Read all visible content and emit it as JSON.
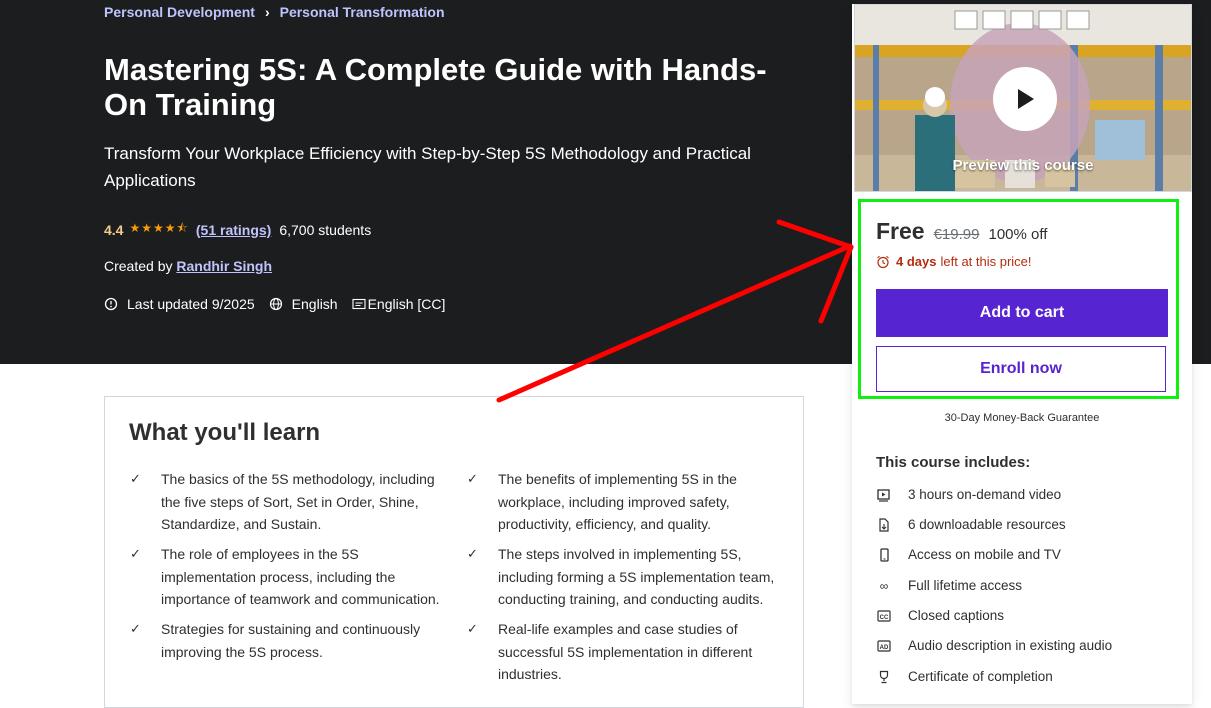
{
  "breadcrumb": {
    "items": [
      "Personal Development",
      "Personal Transformation"
    ]
  },
  "course": {
    "title": "Mastering 5S: A Complete Guide with Hands-On Training",
    "subtitle": "Transform Your Workplace Efficiency with Step-by-Step 5S Methodology and Practical Applications",
    "rating": "4.4",
    "rating_stars": 4.4,
    "ratings_count_label": "(51 ratings)",
    "students": "6,700 students",
    "created_by_label": "Created by",
    "instructor": "Randhir Singh",
    "last_updated": "Last updated 9/2025",
    "language": "English",
    "captions": "English [CC]"
  },
  "learn": {
    "heading": "What you'll learn",
    "items": [
      "The basics of the 5S methodology, including the five steps of Sort, Set in Order, Shine, Standardize, and Sustain.",
      "The benefits of implementing 5S in the workplace, including improved safety, productivity, efficiency, and quality.",
      "The role of employees in the 5S implementation process, including the importance of teamwork and communication.",
      "The steps involved in implementing 5S, including forming a 5S implementation team, conducting training, and conducting audits.",
      "Strategies for sustaining and continuously improving the 5S process.",
      "Real-life examples and case studies of successful 5S implementation in different industries."
    ]
  },
  "sidebar": {
    "preview_label": "Preview this course",
    "price": "Free",
    "original_price": "€19.99",
    "discount": "100% off",
    "timer_days": "4 days",
    "timer_text": "left at this price!",
    "add_to_cart": "Add to cart",
    "enroll_now": "Enroll now",
    "guarantee": "30-Day Money-Back Guarantee",
    "includes_title": "This course includes:",
    "includes": [
      {
        "icon": "video-icon",
        "label": "3 hours on-demand video"
      },
      {
        "icon": "download-file-icon",
        "label": "6 downloadable resources"
      },
      {
        "icon": "mobile-icon",
        "label": "Access on mobile and TV"
      },
      {
        "icon": "infinity-icon",
        "label": "Full lifetime access"
      },
      {
        "icon": "closed-captions-icon",
        "label": "Closed captions"
      },
      {
        "icon": "audio-description-icon",
        "label": "Audio description in existing audio"
      },
      {
        "icon": "trophy-icon",
        "label": "Certificate of completion"
      }
    ]
  },
  "colors": {
    "hero_bg": "#1c1d1f",
    "link_purple": "#c0c4fc",
    "brand_purple": "#5624d0",
    "star_orange": "#f69c08",
    "timer_red": "#b32d0f",
    "annotation_red": "#ff0000",
    "annotation_green": "#10f010"
  }
}
